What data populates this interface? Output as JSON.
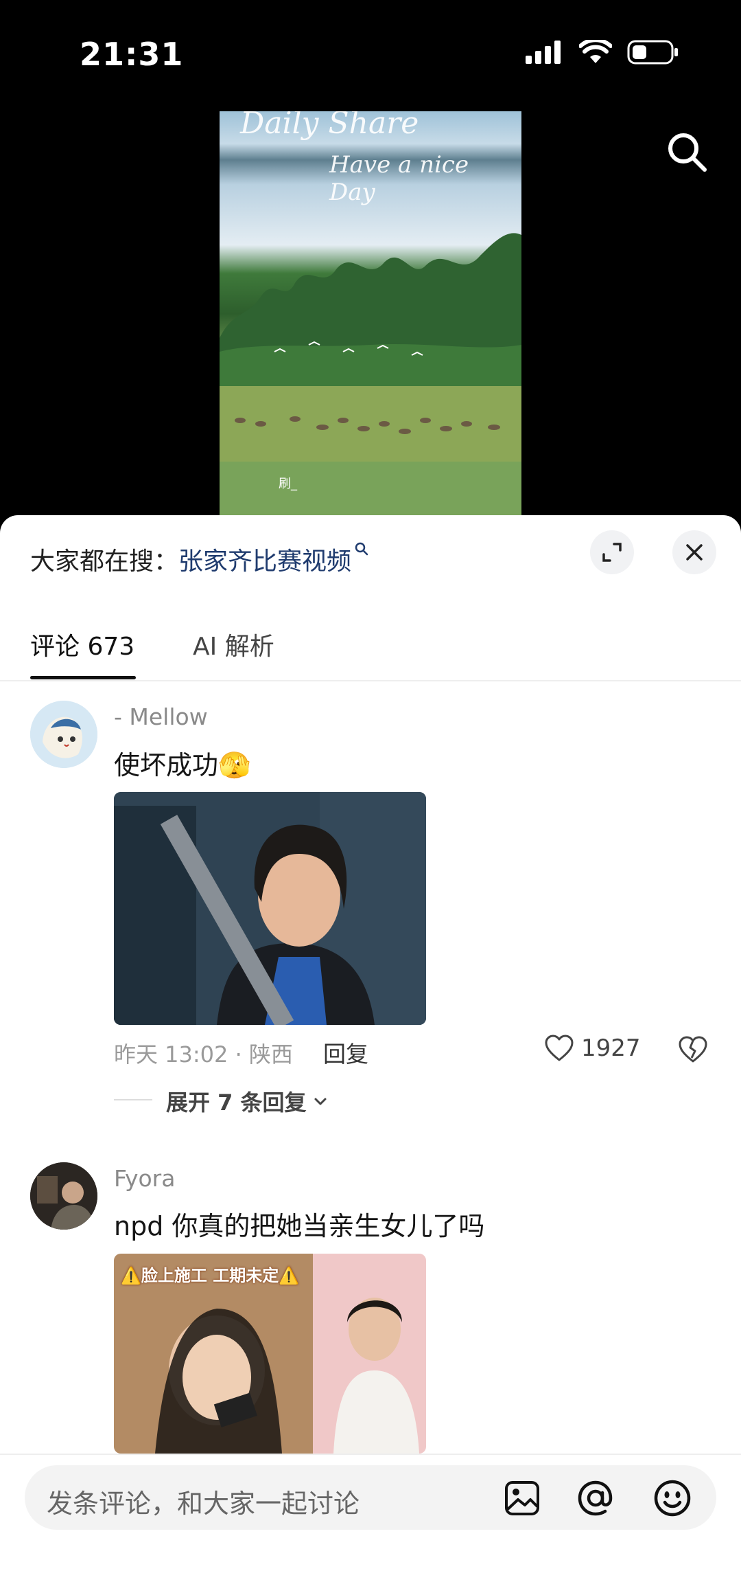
{
  "status_bar": {
    "time": "21:31"
  },
  "video": {
    "overlay_title": "Daily Share",
    "overlay_subtitle": "Have a nice Day",
    "caption_fragment": "刷_"
  },
  "search_hint": {
    "prefix": "大家都在搜：",
    "keyword": "张家齐比赛视频"
  },
  "tabs": [
    {
      "label": "评论 673",
      "active": true
    },
    {
      "label": "AI 解析",
      "active": false
    }
  ],
  "comments": [
    {
      "username": "- Mellow",
      "text": "使坏成功",
      "emoji": "🫣",
      "time": "昨天 13:02 · 陕西",
      "reply_label": "回复",
      "likes": "1927",
      "expand_label": "展开 7 条回复"
    },
    {
      "username": "Fyora",
      "text": "npd 你真的把她当亲生女儿了吗",
      "image_caption": "⚠️脸上施工 工期未定⚠️"
    }
  ],
  "composer": {
    "placeholder": "发条评论，和大家一起讨论"
  },
  "colors": {
    "sheet_bg": "#ffffff",
    "keyword": "#1f3b6e",
    "screen_bg": "#000000"
  },
  "icons": [
    "search-icon",
    "expand-icon",
    "close-icon",
    "heart-icon",
    "broken-heart-icon",
    "chevron-down-icon",
    "image-icon",
    "at-icon",
    "emoji-icon"
  ]
}
